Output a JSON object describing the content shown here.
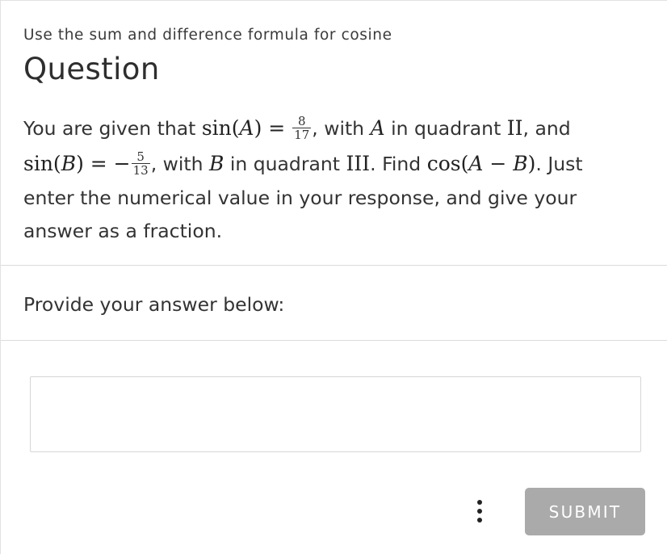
{
  "header": {
    "subtitle": "Use the sum and difference formula for cosine",
    "title": "Question"
  },
  "question": {
    "l1_a": "You are given that ",
    "l1_m1": "sin(",
    "l1_m2": "A",
    "l1_m3": ") = ",
    "l1_f_num": "8",
    "l1_f_den": "17",
    "l1_b": ", with ",
    "l1_m4": "A",
    "l1_c": " in quadrant ",
    "l1_m5": "II",
    "l1_d": ", and",
    "l2_m1": "sin(",
    "l2_m2": "B",
    "l2_m3": ") = −",
    "l2_f_num": "5",
    "l2_f_den": "13",
    "l2_a": ", with ",
    "l2_m4": "B",
    "l2_b": " in quadrant ",
    "l2_m5": "III",
    "l2_c": ". Find ",
    "l2_m6": "cos(",
    "l2_m7": "A",
    "l2_m8": " − ",
    "l2_m9": "B",
    "l2_m10": ")",
    "l2_d": ". Just",
    "l3": "enter the numerical value in your response, and give your",
    "l4": "answer as a fraction."
  },
  "answer": {
    "prompt": "Provide your answer below:",
    "value": "",
    "placeholder": ""
  },
  "actions": {
    "more_icon": "vertical-ellipsis",
    "submit_label": "SUBMIT",
    "submit_color": "#aaaaaa"
  }
}
